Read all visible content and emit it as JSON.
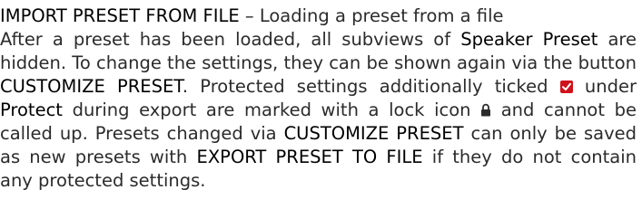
{
  "heading": {
    "title": "IMPORT PRESET FROM FILE",
    "dash": " – ",
    "subtitle": "Loading a preset from a file"
  },
  "paragraph": {
    "l2_a": "After a preset has been loaded, all subviews of ",
    "l2_b": "Speaker Preset",
    "l2_c": " are",
    "l3": "hidden. To change the settings, they can be shown again via the button",
    "l4_a": "CUSTOMIZE PRESET",
    "l4_b": ". Protected settings additionally ticked ",
    "l4_c": " under",
    "l5_a": "Protect",
    "l5_b": " during export are marked with a lock icon ",
    "l5_c": " and cannot be",
    "l6_a": "called up. Presets changed via ",
    "l6_b": "CUSTOMIZE PRESET",
    "l6_c": " can only be saved",
    "l7_a": "as new presets with ",
    "l7_b": "EXPORT PRESET TO FILE",
    "l7_c": " if they do not contain",
    "l8": "any protected settings."
  },
  "icons": {
    "checkbox": "checked-checkbox-icon",
    "lock": "lock-icon"
  },
  "colors": {
    "text": "#2b2b2b",
    "checkbox": "#d0121b"
  }
}
